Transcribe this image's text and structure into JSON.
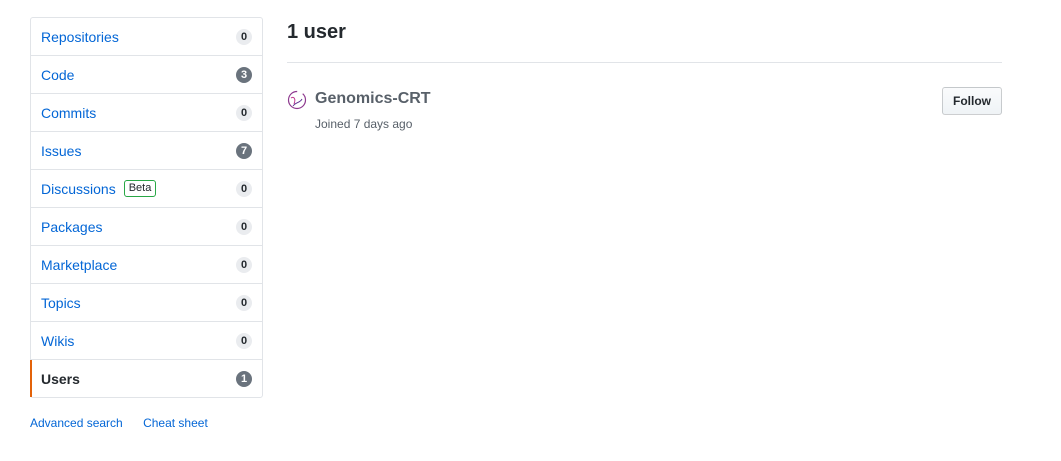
{
  "sidebar": {
    "items": [
      {
        "label": "Repositories",
        "count": "0",
        "counter_style": "light"
      },
      {
        "label": "Code",
        "count": "3",
        "counter_style": "dark"
      },
      {
        "label": "Commits",
        "count": "0",
        "counter_style": "light"
      },
      {
        "label": "Issues",
        "count": "7",
        "counter_style": "dark"
      },
      {
        "label": "Discussions",
        "badge": "Beta",
        "count": "0",
        "counter_style": "light"
      },
      {
        "label": "Packages",
        "count": "0",
        "counter_style": "light"
      },
      {
        "label": "Marketplace",
        "count": "0",
        "counter_style": "light"
      },
      {
        "label": "Topics",
        "count": "0",
        "counter_style": "light"
      },
      {
        "label": "Wikis",
        "count": "0",
        "counter_style": "light"
      },
      {
        "label": "Users",
        "count": "1",
        "counter_style": "dark",
        "selected": true
      }
    ],
    "links": {
      "advanced_search": "Advanced search",
      "cheat_sheet": "Cheat sheet"
    }
  },
  "main": {
    "title": "1 user",
    "users": [
      {
        "name": "Genomics-CRT",
        "joined": "Joined 7 days ago",
        "follow_label": "Follow"
      }
    ]
  },
  "colors": {
    "link": "#0366d6",
    "selected_indicator": "#e36209",
    "beta_border": "#28a745",
    "avatar_stroke": "#8e3a8f"
  }
}
